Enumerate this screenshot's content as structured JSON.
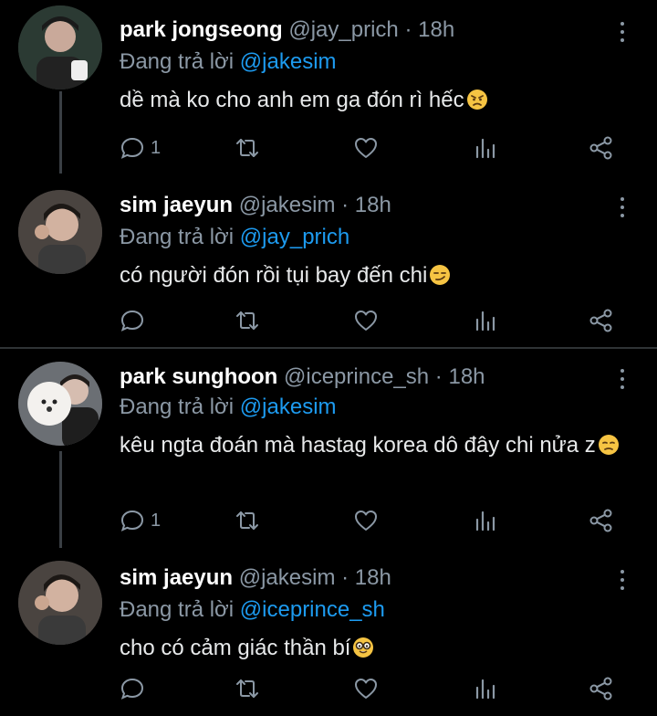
{
  "colors": {
    "background": "#000000",
    "accent": "#1d9bf0",
    "muted": "#8b98a5",
    "text": "#e7e9ea"
  },
  "tweets": [
    {
      "name": "park jongseong",
      "handle": "@jay_prich",
      "dot": "·",
      "time": "18h",
      "reply_prefix": "Đang trả lời",
      "reply_to": "@jakesim",
      "text": "dề mà ko cho anh em ga đón rì hếc",
      "emoji": "angry-face",
      "reply_count": "1",
      "retweet_count": "",
      "like_count": ""
    },
    {
      "name": "sim jaeyun",
      "handle": "@jakesim",
      "dot": "·",
      "time": "18h",
      "reply_prefix": "Đang trả lời",
      "reply_to": "@jay_prich",
      "text": "có người đón rồi tụi bay đến chi",
      "emoji": "smirking-face",
      "reply_count": "",
      "retweet_count": "",
      "like_count": ""
    },
    {
      "name": "park sunghoon",
      "handle": "@iceprince_sh",
      "dot": "·",
      "time": "18h",
      "reply_prefix": "Đang trả lời",
      "reply_to": "@jakesim",
      "text": "kêu ngta đoán mà hastag korea dô đây chi nửa z",
      "emoji": "unamused-face",
      "reply_count": "1",
      "retweet_count": "",
      "like_count": ""
    },
    {
      "name": "sim jaeyun",
      "handle": "@jakesim",
      "dot": "·",
      "time": "18h",
      "reply_prefix": "Đang trả lời",
      "reply_to": "@iceprince_sh",
      "text": "cho có cảm giác thần bí",
      "emoji": "nerd-face",
      "reply_count": "",
      "retweet_count": "",
      "like_count": ""
    }
  ]
}
